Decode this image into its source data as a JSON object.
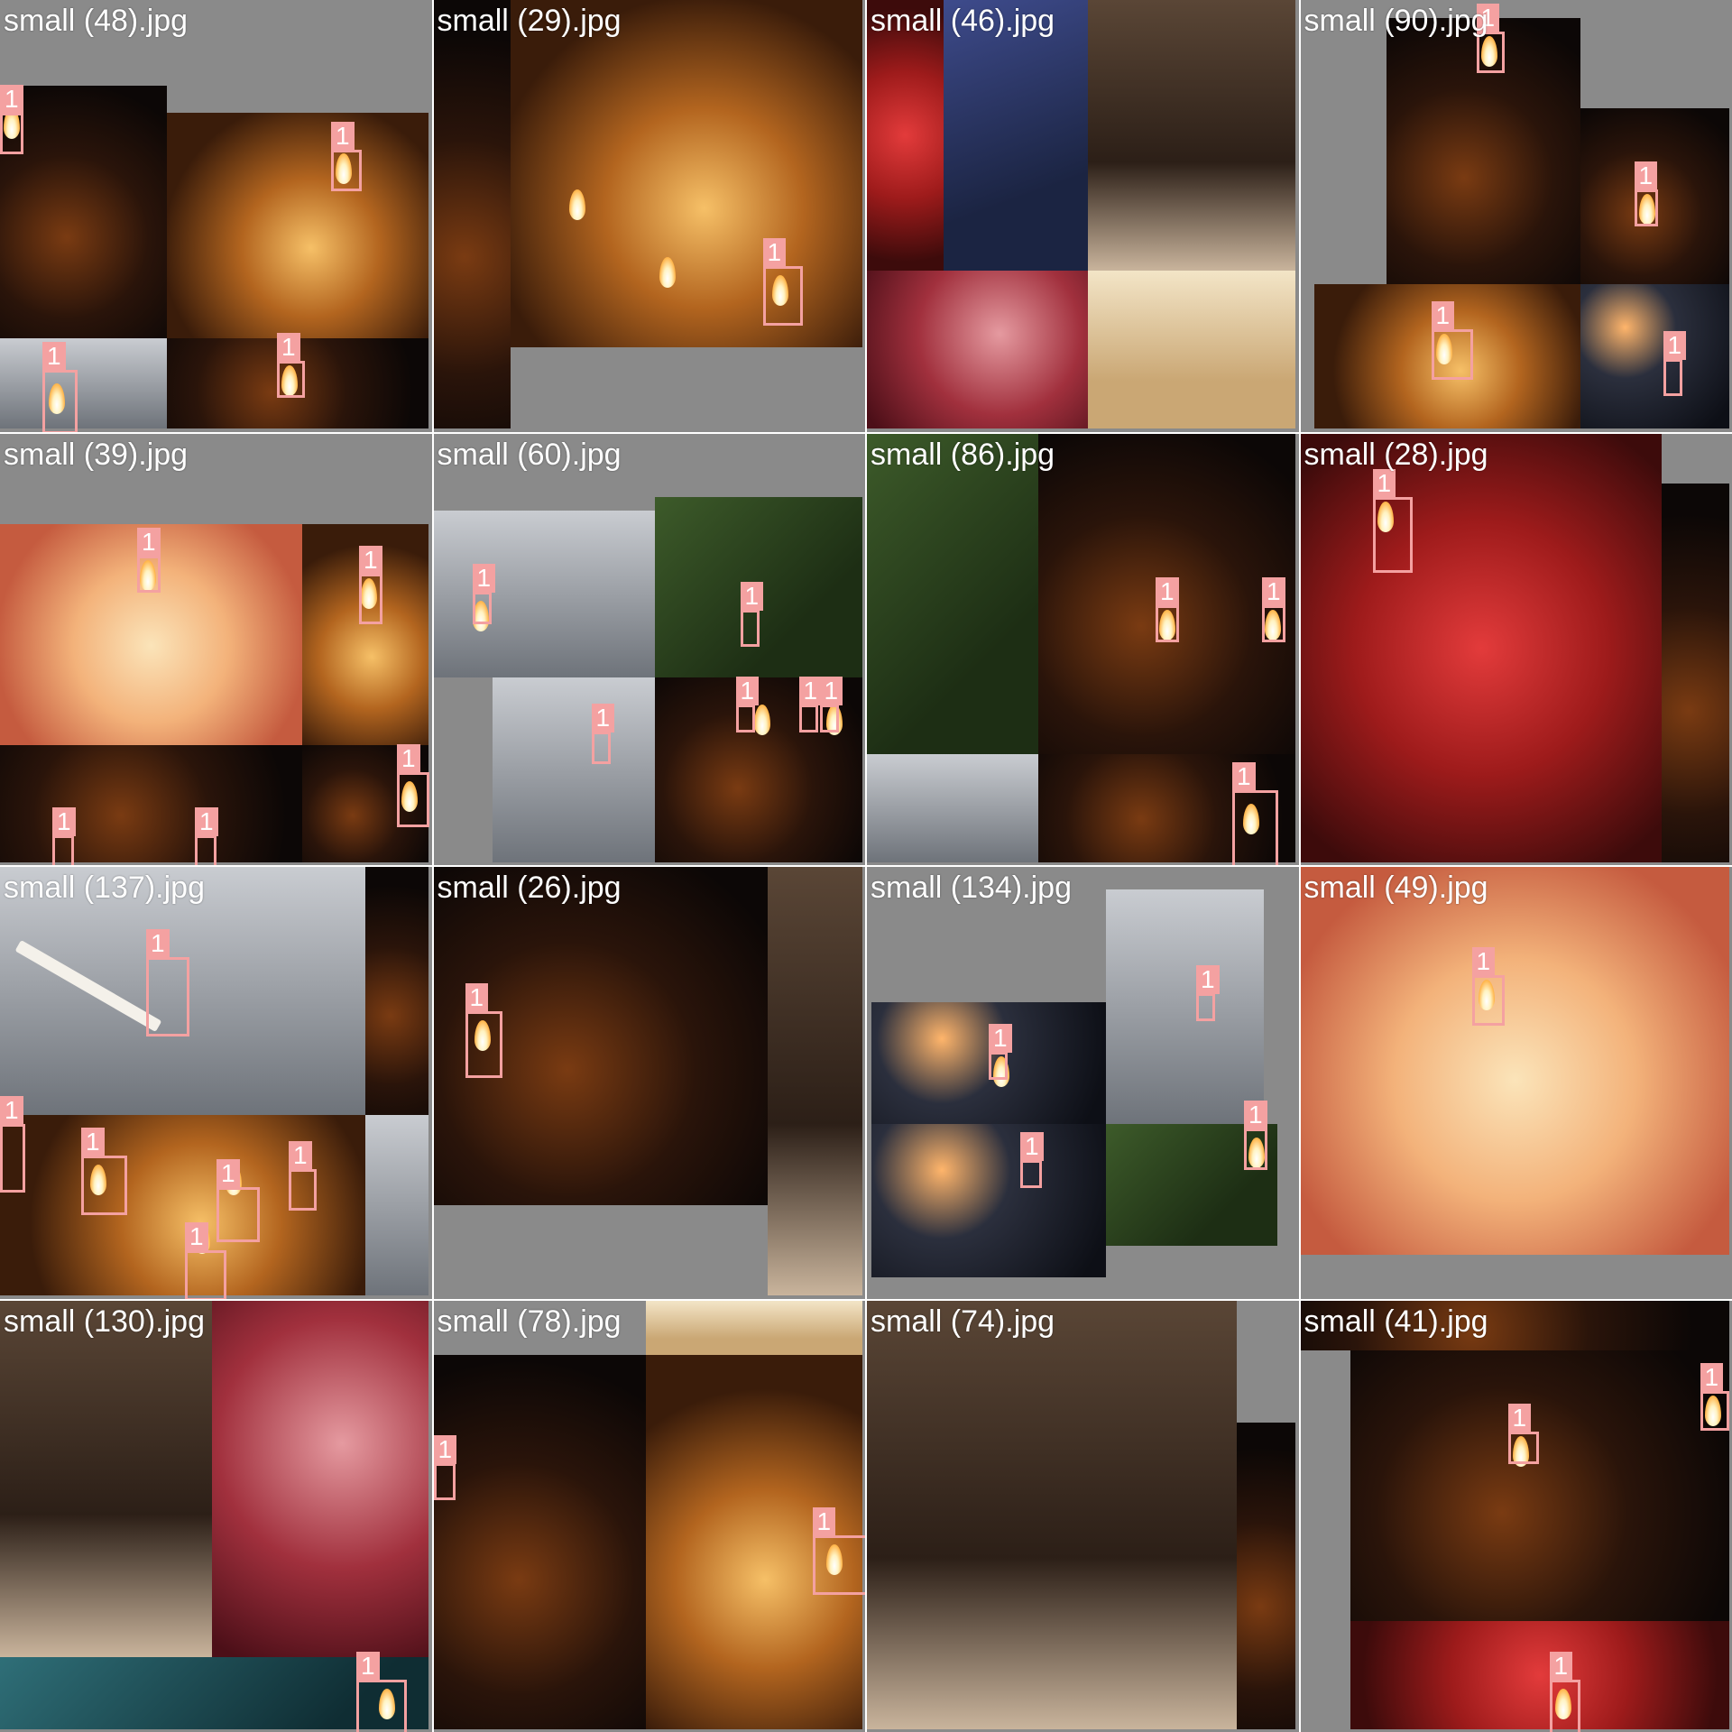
{
  "grid": {
    "tiles": [
      {
        "title": "small (48).jpg",
        "boxes": [
          {
            "label": "1"
          },
          {
            "label": "1"
          },
          {
            "label": "1"
          },
          {
            "label": "1"
          }
        ]
      },
      {
        "title": "small (29).jpg",
        "boxes": [
          {
            "label": "1"
          }
        ]
      },
      {
        "title": "small (46).jpg",
        "boxes": []
      },
      {
        "title": "small (90).jpg",
        "boxes": [
          {
            "label": "1"
          },
          {
            "label": "1"
          },
          {
            "label": "1"
          },
          {
            "label": "1"
          }
        ]
      },
      {
        "title": "small (39).jpg",
        "boxes": [
          {
            "label": "1"
          },
          {
            "label": "1"
          },
          {
            "label": "1"
          },
          {
            "label": "1"
          },
          {
            "label": "1"
          }
        ]
      },
      {
        "title": "small (60).jpg",
        "boxes": [
          {
            "label": "1"
          },
          {
            "label": "1"
          },
          {
            "label": "1"
          },
          {
            "label": "1"
          },
          {
            "label": "1"
          },
          {
            "label": "1"
          }
        ]
      },
      {
        "title": "small (86).jpg",
        "boxes": [
          {
            "label": "1"
          },
          {
            "label": "1"
          },
          {
            "label": "1"
          }
        ]
      },
      {
        "title": "small (28).jpg",
        "boxes": [
          {
            "label": "1"
          }
        ]
      },
      {
        "title": "small (137).jpg",
        "boxes": [
          {
            "label": "1"
          },
          {
            "label": "1"
          },
          {
            "label": "1"
          },
          {
            "label": "1"
          },
          {
            "label": "1"
          },
          {
            "label": "1"
          }
        ]
      },
      {
        "title": "small (26).jpg",
        "boxes": [
          {
            "label": "1"
          }
        ]
      },
      {
        "title": "small (134).jpg",
        "boxes": [
          {
            "label": "1"
          },
          {
            "label": "1"
          },
          {
            "label": "1"
          },
          {
            "label": "1"
          }
        ]
      },
      {
        "title": "small (49).jpg",
        "boxes": [
          {
            "label": "1"
          }
        ]
      },
      {
        "title": "small (130).jpg",
        "boxes": [
          {
            "label": "1"
          }
        ]
      },
      {
        "title": "small (78).jpg",
        "boxes": [
          {
            "label": "1"
          },
          {
            "label": "1"
          }
        ]
      },
      {
        "title": "small (74).jpg",
        "boxes": []
      },
      {
        "title": "small (41).jpg",
        "boxes": [
          {
            "label": "1"
          },
          {
            "label": "1"
          },
          {
            "label": "1"
          }
        ]
      }
    ]
  },
  "colors": {
    "box": "#f4a1a1",
    "background": "#8a8a8a",
    "title": "#ffffff"
  }
}
